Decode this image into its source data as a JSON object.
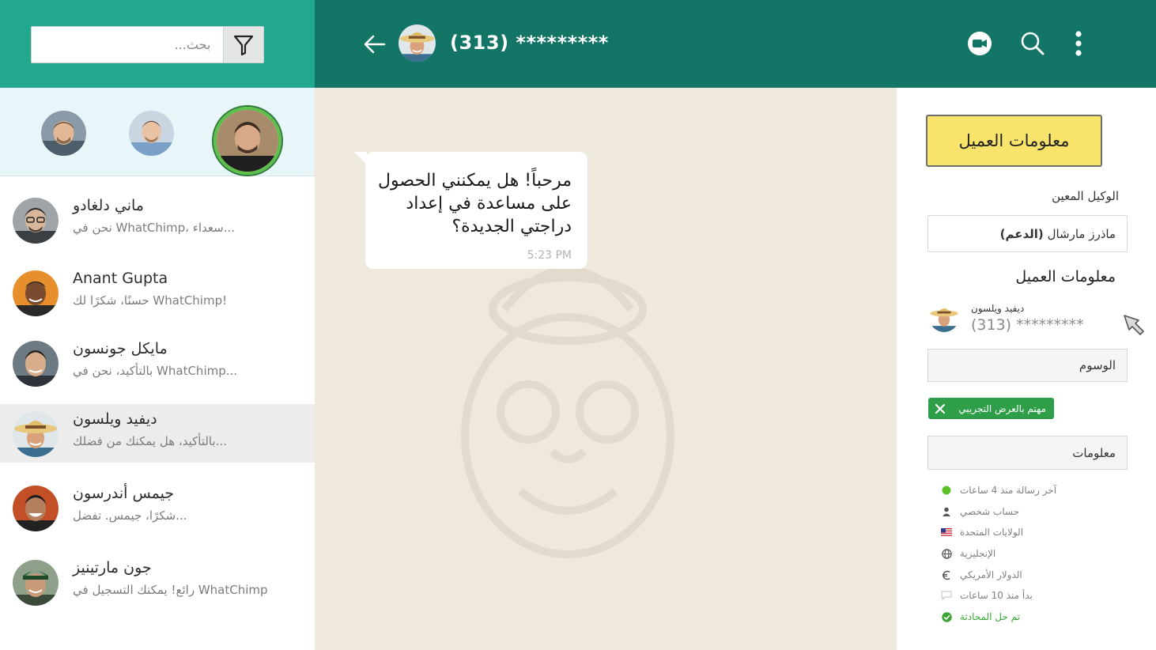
{
  "search": {
    "placeholder": "بحث..."
  },
  "chat_header": {
    "phone": "(313) *********"
  },
  "conversations": [
    {
      "name": "ماني دلغادو",
      "preview": "نحن في WhatChimp، سعداء..."
    },
    {
      "name": "Anant Gupta",
      "preview": "حسنًا، شكرًا لك WhatChimp!"
    },
    {
      "name": "مايكل جونسون",
      "preview": "بالتأكيد، نحن في WhatChimp..."
    },
    {
      "name": "ديفيد ويلسون",
      "preview": "بالتأكيد، هل يمكنك من فضلك..."
    },
    {
      "name": "جيمس أندرسون",
      "preview": "شكرًا، جيمس. تفضل..."
    },
    {
      "name": "جون مارتينيز",
      "preview": "رائع! يمكنك التسجيل في WhatChimp"
    }
  ],
  "message": {
    "text": "مرحباً! هل يمكنني الحصول على مساعدة في إعداد دراجتي الجديدة؟",
    "time": "5:23 PM"
  },
  "info_panel": {
    "customer_info_button": "معلومات العميل",
    "assigned_agent_label": "الوكيل المعين",
    "agent_name": "ماذرز مارشال",
    "agent_role": "(الدعم)",
    "customer_info_heading": "معلومات العميل",
    "customer_name": "ديفيد ويلسون",
    "customer_phone": "(313) *********",
    "tags_label": "الوسوم",
    "tag": "مهتم بالعرض التجريبي",
    "info_label": "معلومات",
    "meta": [
      {
        "icon": "green-dot-icon",
        "text": "آخر رسالة منذ 4 ساعات"
      },
      {
        "icon": "person-icon",
        "text": "حساب شخصي"
      },
      {
        "icon": "us-flag-icon",
        "text": "الولايات المتحدة"
      },
      {
        "icon": "globe-icon",
        "text": "الإنجليزية"
      },
      {
        "icon": "euro-icon",
        "text": "الدولار الأمريكي"
      },
      {
        "icon": "chat-bubble-icon",
        "text": "بدأ منذ 10 ساعات"
      },
      {
        "icon": "check-circle-icon",
        "text": "تم حل المحادثة"
      }
    ]
  },
  "colors": {
    "left_header": "#22a88f",
    "chat_header": "#127565",
    "chat_bg": "#eee8dd",
    "favorites_bg": "#e8f5f9",
    "button_yellow": "#f9e46b",
    "tag_green": "#2e9f48"
  }
}
